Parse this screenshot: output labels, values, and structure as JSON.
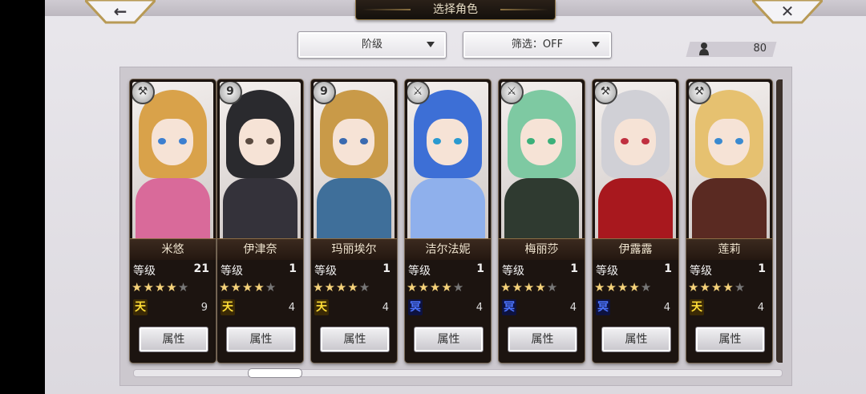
{
  "header": {
    "title": "选择角色",
    "back_icon": "←",
    "close_icon": "✕"
  },
  "filters": {
    "grade_label": "阶级",
    "filter_label": "筛选：OFF"
  },
  "roster_count": "80",
  "level_label": "等级",
  "attr_label": "属性",
  "colors": {
    "star_on": "#f5d27a",
    "star_off": "#777777",
    "rank_tian": "#ffde37",
    "rank_ming": "#4c74ff"
  },
  "cards": [
    {
      "name": "米悠",
      "level": "21",
      "stars": 4,
      "weapon_icon": "axe-icon",
      "weapon_glyph": "⚒",
      "rank": "天",
      "rank_type": "tian",
      "rank_count": "9",
      "palette": {
        "hair": "#d9a24a",
        "body": "#d96a9a",
        "eye": "#3c7fd0"
      }
    },
    {
      "name": "伊津奈",
      "level": "1",
      "stars": 4,
      "weapon_icon": "nine-icon",
      "weapon_glyph": "9",
      "rank": "天",
      "rank_type": "tian",
      "rank_count": "4",
      "palette": {
        "hair": "#2a2a2e",
        "body": "#34323a",
        "eye": "#5a4a40"
      }
    },
    {
      "name": "玛丽埃尔",
      "level": "1",
      "stars": 4,
      "weapon_icon": "nine-icon",
      "weapon_glyph": "9",
      "rank": "天",
      "rank_type": "tian",
      "rank_count": "4",
      "palette": {
        "hair": "#c99a48",
        "body": "#3f6f9a",
        "eye": "#3a6ab0"
      }
    },
    {
      "name": "洁尔法妮",
      "level": "1",
      "stars": 4,
      "weapon_icon": "sword-icon",
      "weapon_glyph": "⚔",
      "rank": "冥",
      "rank_type": "ming",
      "rank_count": "4",
      "palette": {
        "hair": "#3d6fd6",
        "body": "#8fb0ec",
        "eye": "#2a9ad0"
      }
    },
    {
      "name": "梅丽莎",
      "level": "1",
      "stars": 4,
      "weapon_icon": "sword-icon",
      "weapon_glyph": "⚔",
      "rank": "冥",
      "rank_type": "ming",
      "rank_count": "4",
      "palette": {
        "hair": "#7ec9a2",
        "body": "#2f3a30",
        "eye": "#3bb07a"
      }
    },
    {
      "name": "伊露露",
      "level": "1",
      "stars": 4,
      "weapon_icon": "axe-icon",
      "weapon_glyph": "⚒",
      "rank": "冥",
      "rank_type": "ming",
      "rank_count": "4",
      "palette": {
        "hair": "#d0d0d6",
        "body": "#a8181e",
        "eye": "#c03040"
      }
    },
    {
      "name": "莲莉",
      "level": "1",
      "stars": 4,
      "weapon_icon": "axe-icon",
      "weapon_glyph": "⚒",
      "rank": "天",
      "rank_type": "tian",
      "rank_count": "4",
      "palette": {
        "hair": "#e6c170",
        "body": "#5a2a22",
        "eye": "#3a8ad0"
      }
    }
  ]
}
